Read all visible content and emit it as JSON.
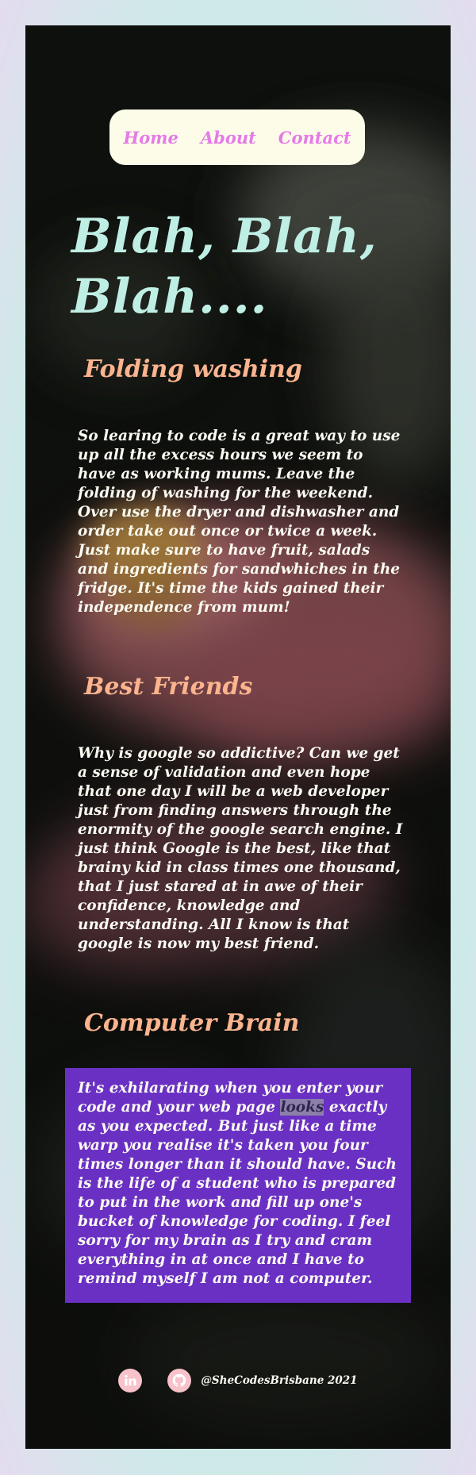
{
  "nav": {
    "items": [
      {
        "label": "Home"
      },
      {
        "label": "About"
      },
      {
        "label": "Contact"
      }
    ]
  },
  "hero": {
    "title": "Blah, Blah, Blah...."
  },
  "sections": [
    {
      "heading": "Folding washing",
      "body": "So learing to code is a great way to use up all the excess hours we seem to have as working mums. Leave the folding of washing for the weekend. Over use the dryer and dishwasher and order take out once or twice a week. Just make sure to have fruit, salads and ingredients for sandwhiches in the fridge. It's time the kids gained their independence from mum!"
    },
    {
      "heading": "Best Friends",
      "body_part1": "Why is google so addictive? Can we get a sense of validation and even hope that one day I will be a web developer just from finding answers through the enormity of the google search engine. I just think Google is the best, like that brainy kid in class ",
      "body_emphasis": "times",
      "body_part2": " one thousand, that I just stared at in awe of their confidence, knowledge and understanding. All I know is that google is now my best friend."
    },
    {
      "heading": "Computer Brain",
      "body_part1": "It's exhilarating when you enter your code and your web page ",
      "body_highlight": "looks",
      "body_part2": " exactly as you expected. But just like a time warp you realise it's taken you four times longer than it should have. Such is the life of a student who is prepared to put in the work and fill up one's bucket of knowledge for coding. I feel sorry for my brain as I try and cram everything in at once and I have to remind myself I am not a computer."
    }
  ],
  "footer": {
    "credit": "@SheCodesBrisbane 2021",
    "icons": [
      "linkedin-icon",
      "github-icon"
    ]
  },
  "colors": {
    "nav_bg": "#fcfce8",
    "nav_link": "#e57ae8",
    "hero_title": "#bfeee4",
    "heading": "#fbb48e",
    "body_text": "#fbfbf2",
    "purple_box": "#6a30c3",
    "social_bg": "#f7c2c9",
    "page_border": "#c9ecea"
  }
}
